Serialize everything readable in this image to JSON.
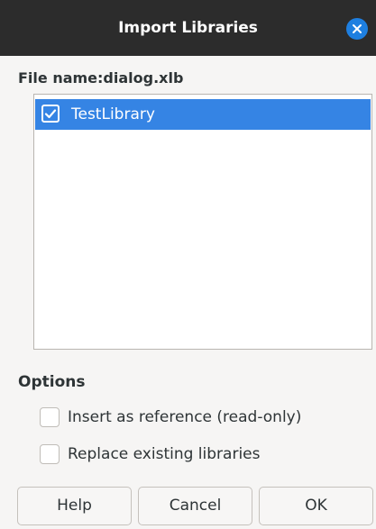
{
  "window": {
    "title": "Import Libraries",
    "close_icon": "close-icon"
  },
  "file": {
    "label": "File name:dialog.xlb"
  },
  "libraries": [
    {
      "name": "TestLibrary",
      "checked": true,
      "selected": true
    }
  ],
  "options": {
    "heading": "Options",
    "items": [
      {
        "label": "Insert as reference (read-only)",
        "checked": false
      },
      {
        "label": "Replace existing libraries",
        "checked": false
      }
    ]
  },
  "buttons": {
    "help": "Help",
    "cancel": "Cancel",
    "ok": "OK"
  },
  "colors": {
    "accent": "#3584e4",
    "titlebar": "#2c2c2c",
    "close_button": "#1e7fe0"
  }
}
